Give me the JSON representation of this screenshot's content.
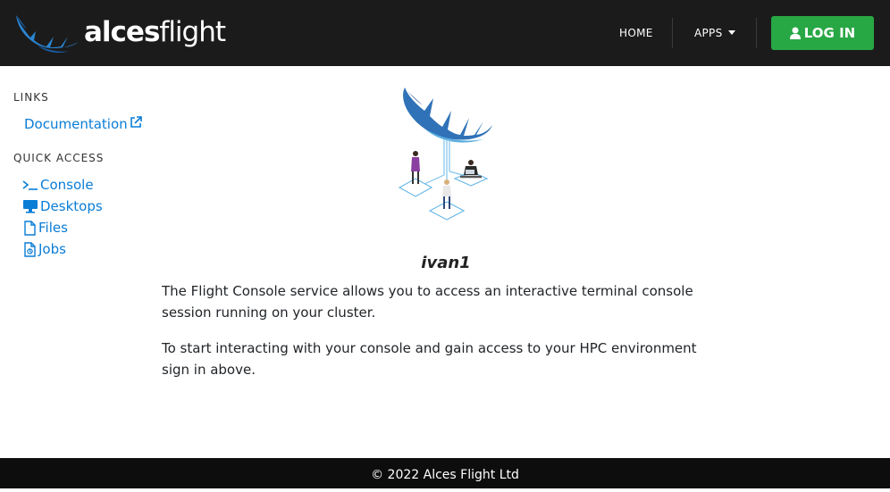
{
  "brand": {
    "name_bold": "alces",
    "name_light": "flight"
  },
  "nav": {
    "home": "HOME",
    "apps": "APPS",
    "login": "LOG IN"
  },
  "sidebar": {
    "links_heading": "LINKS",
    "documentation": "Documentation",
    "quick_heading": "QUICK ACCESS",
    "items": [
      {
        "label": "Console",
        "icon": "terminal-icon"
      },
      {
        "label": "Desktops",
        "icon": "monitor-icon"
      },
      {
        "label": "Files",
        "icon": "file-icon"
      },
      {
        "label": "Jobs",
        "icon": "job-file-icon"
      }
    ]
  },
  "main": {
    "cluster_name": "ivan1",
    "paragraph1": "The Flight Console service allows you to access an interactive terminal console session running on your cluster.",
    "paragraph2": "To start interacting with your console and gain access to your HPC environment sign in above."
  },
  "footer": {
    "copyright": "© 2022 Alces Flight Ltd"
  },
  "colors": {
    "topbar": "#1b1b1b",
    "login": "#28a745",
    "link": "#0a7dd6",
    "footer": "#0d0d0d",
    "brand_blue": "#1e78c8"
  }
}
